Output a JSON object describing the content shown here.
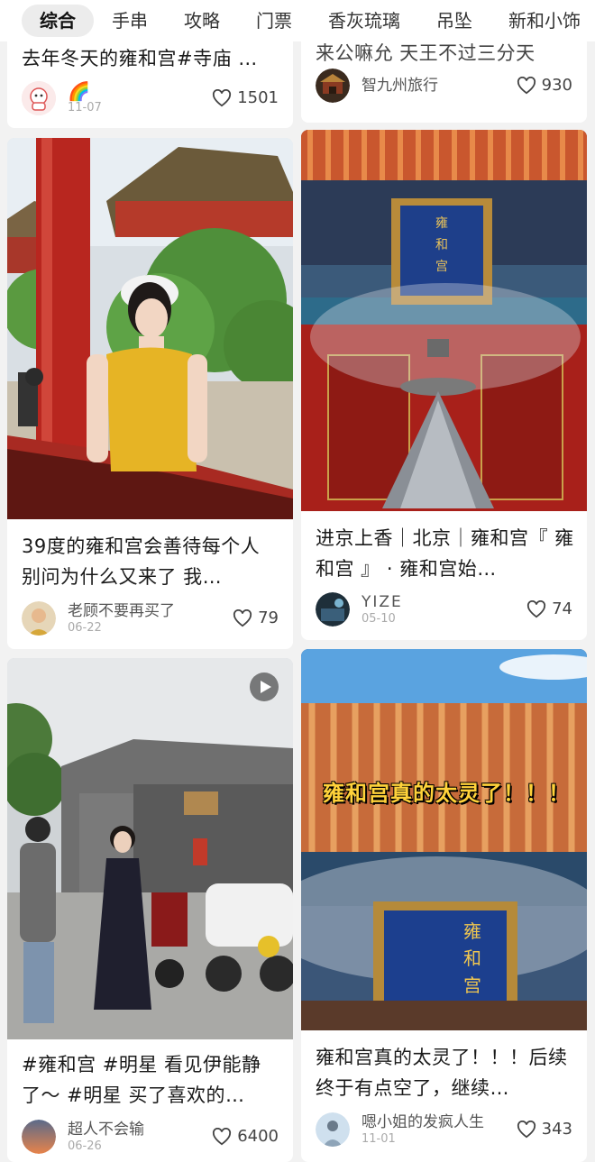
{
  "tabs": [
    "综合",
    "手串",
    "攻略",
    "门票",
    "香灰琉璃",
    "吊坠",
    "新和小饰"
  ],
  "active_tab_index": 0,
  "colors": {
    "card_bg": "#ffffff",
    "page_bg": "#f2f2f2",
    "active_tab_bg": "#ececec",
    "overlay_text": "#ffd23a"
  },
  "icons": {
    "like": "heart-outline-icon",
    "video": "play-icon"
  },
  "cards": [
    {
      "column": "left",
      "title": "去年冬天的雍和宫#寺庙 …",
      "author": "",
      "author_emoji": "🌈",
      "date": "11-07",
      "likes": "1501"
    },
    {
      "column": "right",
      "title": "来公嘛允 天王不过三分天",
      "author": "智九州旅行",
      "date": "",
      "likes": "930"
    },
    {
      "column": "left",
      "title": "39度的雍和宫会善待每个人 别问为什么又来了 我…",
      "author": "老顾不要再买了",
      "date": "06-22",
      "likes": "79"
    },
    {
      "column": "right",
      "title": "进京上香｜北京｜雍和宫『 雍和宫 』 · 雍和宫始…",
      "author": "YIZE",
      "date": "05-10",
      "likes": "74"
    },
    {
      "column": "left",
      "title": "#雍和宫 #明星 看见伊能静了～ #明星 买了喜欢的…",
      "author": "超人不会输",
      "date": "06-26",
      "likes": "6400",
      "is_video": true
    },
    {
      "column": "right",
      "title": "雍和宫真的太灵了！！！后续 终于有点空了，继续…",
      "author": "嗯小姐的发疯人生",
      "date": "11-01",
      "likes": "343",
      "image_caption": "雍和宫真的太灵了！！！"
    }
  ]
}
